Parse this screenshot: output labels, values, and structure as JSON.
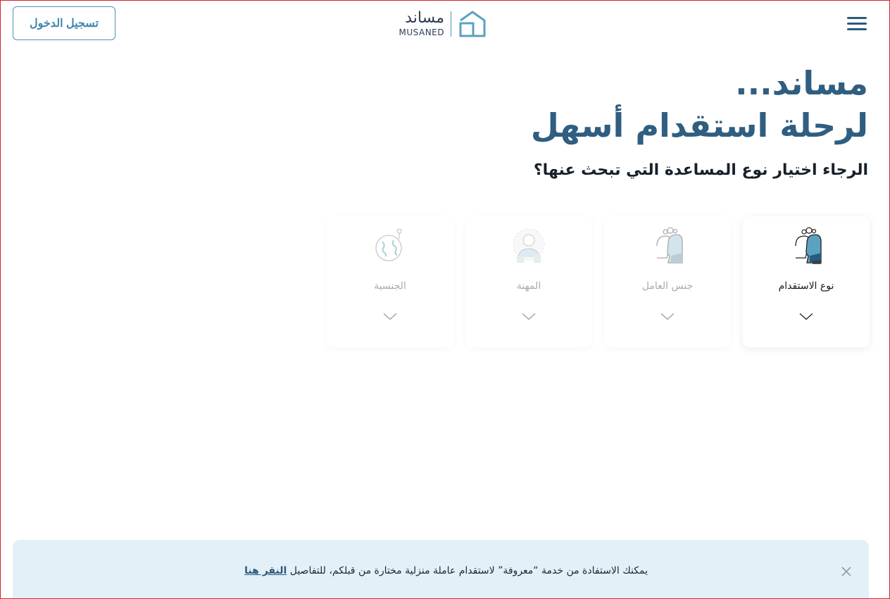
{
  "header": {
    "login_label": "تسجيل الدخول",
    "logo_ar": "مساند",
    "logo_en": "MUSANED",
    "menu_icon": "hamburger-menu-icon"
  },
  "hero": {
    "line1": "مساند...",
    "line2": "لرحلة استقدام أسهل",
    "question": "الرجاء اختيار نوع المساعدة التي تبحث عنها؟"
  },
  "cards": [
    {
      "label": "نوع الاستقدام",
      "icon": "recruitment-type-icon",
      "active": true
    },
    {
      "label": "جنس العامل",
      "icon": "worker-gender-icon",
      "active": false
    },
    {
      "label": "المهنة",
      "icon": "profession-icon",
      "active": false
    },
    {
      "label": "الجنسية",
      "icon": "nationality-globe-icon",
      "active": false
    }
  ],
  "notice": {
    "text": "يمكنك الاستفادة من خدمة “معروفة” لاستقدام عاملة منزلية مختارة من قبلكم، للتفاصيل",
    "link_label": "النقر هنا",
    "close_icon": "close-icon"
  },
  "colors": {
    "primary": "#2f5e80",
    "accent": "#4f93b0",
    "notice_bg": "#e3f0f8"
  }
}
